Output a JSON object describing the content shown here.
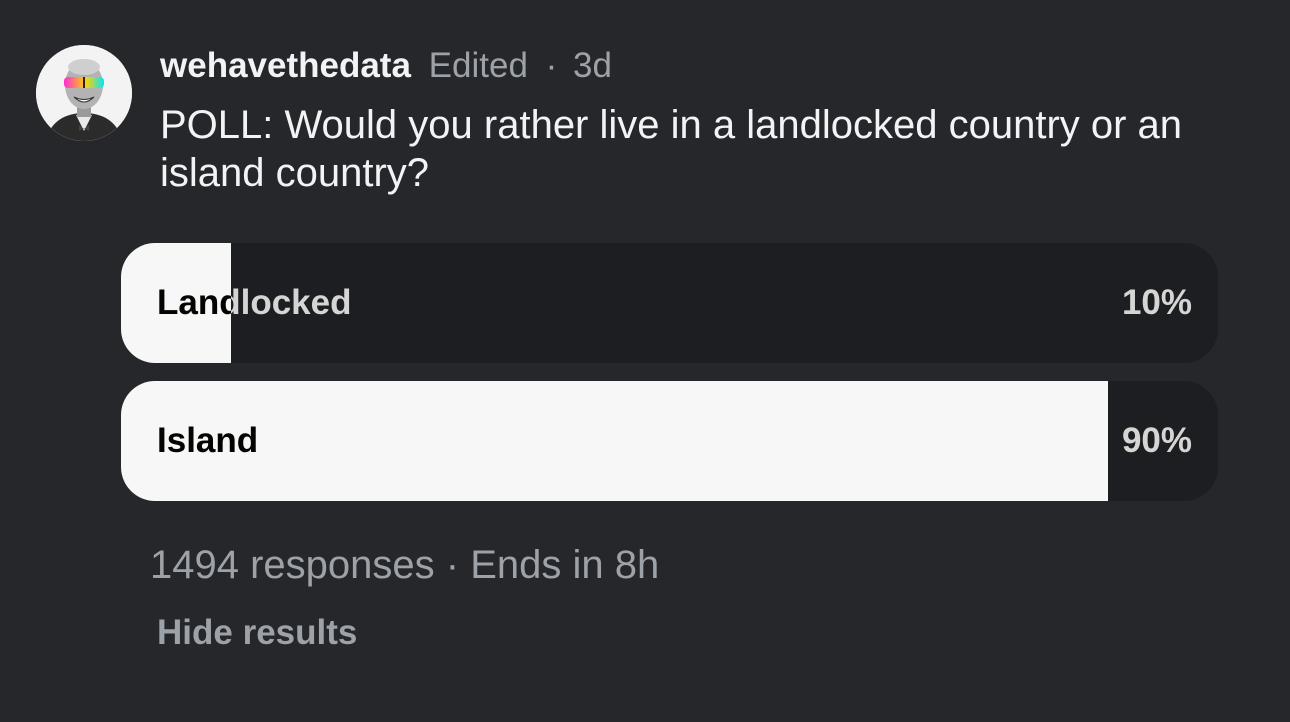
{
  "post": {
    "username": "wehavethedata",
    "edited": "Edited",
    "separator": "·",
    "age": "3d",
    "question": "POLL: Would you rather live in a landlocked country or an island country?"
  },
  "poll": {
    "options": [
      {
        "label": "Landlocked",
        "percent_label": "10%",
        "fraction": 0.1
      },
      {
        "label": "Island",
        "percent_label": "90%",
        "fraction": 0.9
      }
    ],
    "responses": "1494 responses",
    "separator": "·",
    "ends": "Ends in 8h",
    "hide_label": "Hide results"
  },
  "colors": {
    "background": "#25272b",
    "bar_track": "#1d1e21",
    "bar_fill": "#f6f7f6",
    "primary_text": "#f2f3f5",
    "secondary_text": "#9da1a8",
    "sunglasses": [
      "#ff2bd6",
      "#ffd400",
      "#00e5ff"
    ]
  },
  "icons": {
    "avatar": "avatar-portrait-sunglasses"
  }
}
